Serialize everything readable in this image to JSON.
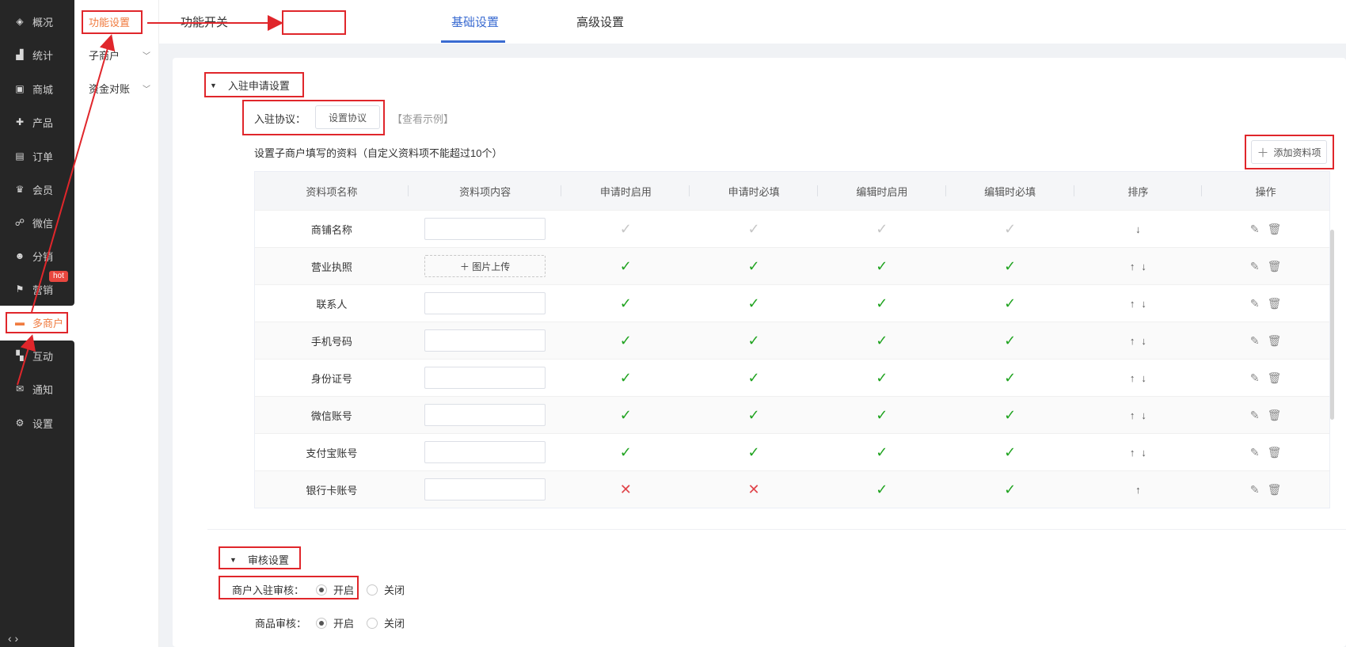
{
  "sidebar": {
    "items": [
      {
        "label": "概况",
        "icon": "layers-icon",
        "glyph": "◈"
      },
      {
        "label": "统计",
        "icon": "chart-icon",
        "glyph": "▟"
      },
      {
        "label": "商城",
        "icon": "store-icon",
        "glyph": "▣"
      },
      {
        "label": "产品",
        "icon": "product-icon",
        "glyph": "✚"
      },
      {
        "label": "订单",
        "icon": "order-icon",
        "glyph": "▤"
      },
      {
        "label": "会员",
        "icon": "crown-icon",
        "glyph": "♛"
      },
      {
        "label": "微信",
        "icon": "wechat-icon",
        "glyph": "☍"
      },
      {
        "label": "分销",
        "icon": "distribution-icon",
        "glyph": "☻"
      },
      {
        "label": "营销",
        "icon": "flag-icon",
        "glyph": "⚑"
      },
      {
        "label": "多商户",
        "icon": "merchant-icon",
        "glyph": "▬"
      },
      {
        "label": "互动",
        "icon": "interact-icon",
        "glyph": "▚"
      },
      {
        "label": "通知",
        "icon": "mail-icon",
        "glyph": "✉"
      },
      {
        "label": "设置",
        "icon": "gear-icon",
        "glyph": "⚙"
      }
    ],
    "hot_badge": "hot",
    "bottom_nav": "‹  ›"
  },
  "subnav": {
    "items": [
      {
        "label": "功能设置"
      },
      {
        "label": "子商户"
      },
      {
        "label": "资金对账"
      }
    ]
  },
  "tabs": [
    {
      "label": "功能开关"
    },
    {
      "label": "基础设置"
    },
    {
      "label": "高级设置"
    }
  ],
  "apply_section": {
    "title": "入驻申请设置",
    "agreement_label": "入驻协议：",
    "agreement_button": "设置协议",
    "example_link": "【查看示例】",
    "fields_hint": "设置子商户填写的资料（自定义资料项不能超过10个）",
    "add_button": "添加资料项"
  },
  "table": {
    "headers": [
      "资料项名称",
      "资料项内容",
      "申请时启用",
      "申请时必填",
      "编辑时启用",
      "编辑时必填",
      "排序",
      "操作"
    ],
    "rows": [
      {
        "name": "商铺名称",
        "content": "input",
        "apply_on": "gray",
        "apply_req": "gray",
        "edit_on": "gray",
        "edit_req": "gray",
        "sort": "↓"
      },
      {
        "name": "营业执照",
        "content": "upload",
        "upload_label": "＋  图片上传",
        "apply_on": "check",
        "apply_req": "check",
        "edit_on": "check",
        "edit_req": "check",
        "sort": "↑↓"
      },
      {
        "name": "联系人",
        "content": "input",
        "apply_on": "check",
        "apply_req": "check",
        "edit_on": "check",
        "edit_req": "check",
        "sort": "↑↓"
      },
      {
        "name": "手机号码",
        "content": "input",
        "apply_on": "check",
        "apply_req": "check",
        "edit_on": "check",
        "edit_req": "check",
        "sort": "↑↓"
      },
      {
        "name": "身份证号",
        "content": "input",
        "apply_on": "check",
        "apply_req": "check",
        "edit_on": "check",
        "edit_req": "check",
        "sort": "↑↓"
      },
      {
        "name": "微信账号",
        "content": "input",
        "apply_on": "check",
        "apply_req": "check",
        "edit_on": "check",
        "edit_req": "check",
        "sort": "↑↓"
      },
      {
        "name": "支付宝账号",
        "content": "input",
        "apply_on": "check",
        "apply_req": "check",
        "edit_on": "check",
        "edit_req": "check",
        "sort": "↑↓"
      },
      {
        "name": "银行卡账号",
        "content": "input",
        "apply_on": "cross",
        "apply_req": "cross",
        "edit_on": "check",
        "edit_req": "check",
        "sort": "↑"
      }
    ]
  },
  "review_section": {
    "title": "审核设置",
    "merchant_review_label": "商户入驻审核：",
    "goods_review_label": "商品审核：",
    "on_label": "开启",
    "off_label": "关闭"
  },
  "colors": {
    "accent": "#3a6bd1",
    "active_orange": "#f07b3f",
    "annotation_red": "#e0262b",
    "check_green": "#1fa31f"
  }
}
